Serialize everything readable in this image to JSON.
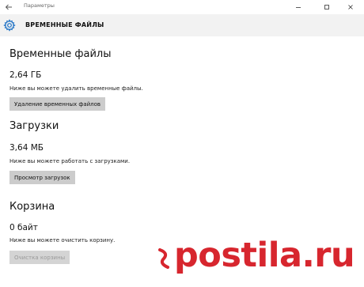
{
  "window": {
    "title": "Параметры"
  },
  "header": {
    "title": "ВРЕМЕННЫЕ ФАЙЛЫ",
    "icon": "gear-icon"
  },
  "sections": [
    {
      "title": "Временные файлы",
      "size": "2,64 ГБ",
      "description": "Ниже вы можете удалить временные файлы.",
      "button_label": "Удаление временных файлов",
      "button_enabled": true
    },
    {
      "title": "Загрузки",
      "size": "3,64 МБ",
      "description": "Ниже вы можете работать с загрузками.",
      "button_label": "Просмотр загрузок",
      "button_enabled": true
    },
    {
      "title": "Корзина",
      "size": "0 байт",
      "description": "Ниже вы можете очистить корзину.",
      "button_label": "Очистка корзины",
      "button_enabled": false
    }
  ],
  "watermark": {
    "text": "postila.ru",
    "color": "#d7262e"
  },
  "colors": {
    "accent": "#1a6fc4",
    "button_bg": "#cccccc",
    "header_bg": "#f2f2f2"
  }
}
